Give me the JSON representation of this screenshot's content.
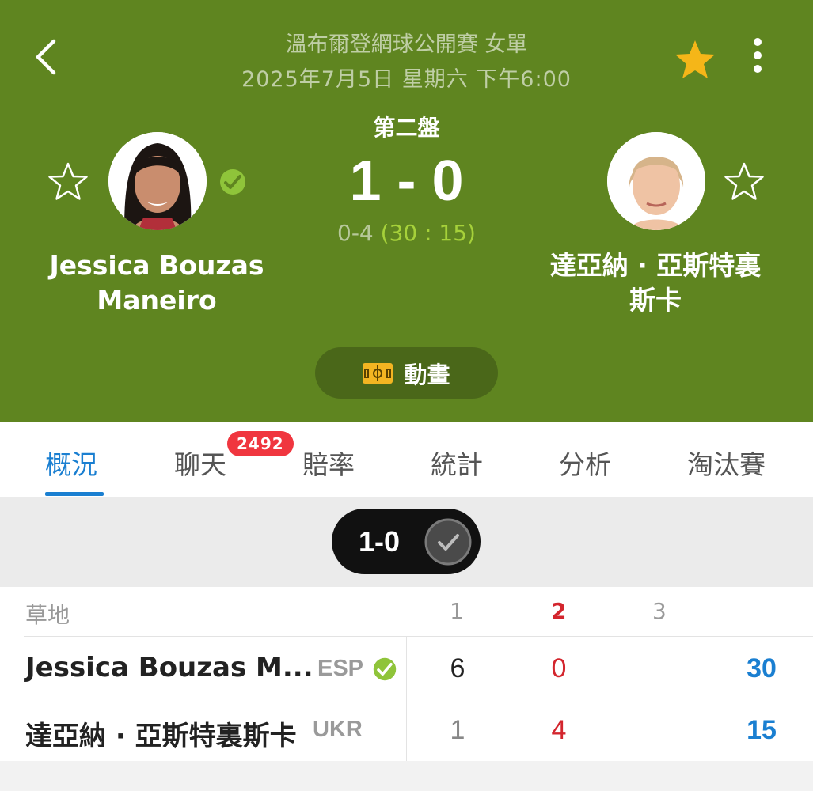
{
  "header": {
    "tournament": "溫布爾登網球公開賽 女單",
    "datetime": "2025年7月5日 星期六 下午6:00",
    "favorite_icon": "star-filled-icon",
    "favorite_color": "#f5b618",
    "background_color": "#5f8520"
  },
  "match": {
    "set_label": "第二盤",
    "sets_score": "1 - 0",
    "games_score": "0-4",
    "points_score": "(30 : 15)"
  },
  "player1": {
    "name_line1": "Jessica Bouzas",
    "name_line2": "Maneiro",
    "serving": true
  },
  "player2": {
    "name_line1": "達亞納 · 亞斯特裏",
    "name_line2": "斯卡"
  },
  "animation_button": {
    "label": "動畫",
    "icon": "field-icon"
  },
  "tabs": [
    {
      "label": "概況",
      "active": true
    },
    {
      "label": "聊天",
      "badge": "2492"
    },
    {
      "label": "賠率"
    },
    {
      "label": "統計"
    },
    {
      "label": "分析"
    },
    {
      "label": "淘汰賽"
    }
  ],
  "set_selector": {
    "label": "1-0"
  },
  "score_table": {
    "surface": "草地",
    "set_headers": [
      "1",
      "2",
      "3"
    ],
    "rows": [
      {
        "name": "Jessica Bouzas M...",
        "country": "ESP",
        "sets": [
          "6",
          "0"
        ],
        "points": "30"
      },
      {
        "name": "達亞納 · 亞斯特裏斯卡",
        "country": "UKR",
        "sets": [
          "1",
          "4"
        ],
        "points": "15"
      }
    ],
    "accent_colors": {
      "current_set": "#d3252d",
      "points": "#1a7fd1"
    }
  }
}
